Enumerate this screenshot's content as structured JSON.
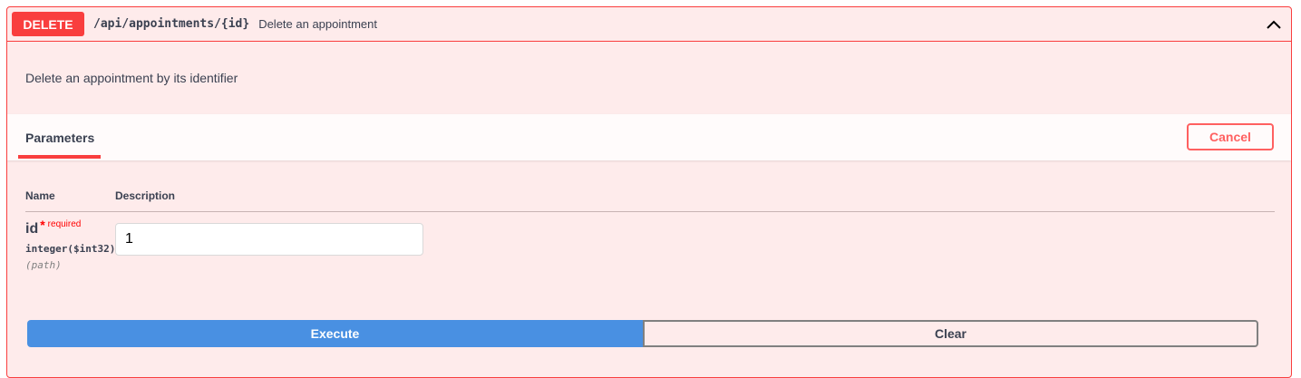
{
  "operation": {
    "method": "DELETE",
    "path": "/api/appointments/{id}",
    "summary": "Delete an appointment",
    "description": "Delete an appointment by its identifier",
    "collapse_icon": "chevron-up-icon",
    "expanded": true
  },
  "parameters_section": {
    "tab_label": "Parameters",
    "cancel_label": "Cancel",
    "columns": {
      "name": "Name",
      "description": "Description"
    },
    "params": [
      {
        "name": "id",
        "required_star": "*",
        "required_label": "required",
        "type": "integer($int32)",
        "in": "(path)",
        "value": "1"
      }
    ]
  },
  "actions": {
    "execute_label": "Execute",
    "clear_label": "Clear"
  },
  "colors": {
    "delete_accent": "#f93e3e",
    "execute_blue": "#4990e2",
    "block_background": "#fae8e8"
  }
}
